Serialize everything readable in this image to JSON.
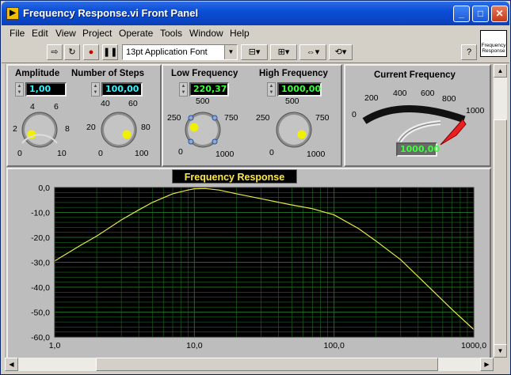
{
  "window": {
    "title": "Frequency Response.vi Front Panel",
    "icon_glyph": "▶"
  },
  "menu": [
    "File",
    "Edit",
    "View",
    "Project",
    "Operate",
    "Tools",
    "Window",
    "Help"
  ],
  "toolbar": {
    "font_label": "13pt Application Font",
    "help_label": "?"
  },
  "vi_icon_label": "Frequency Response",
  "controls": {
    "amplitude": {
      "label": "Amplitude",
      "value": "1,00",
      "ticks": [
        "4",
        "6",
        "2",
        "8",
        "0",
        "10"
      ],
      "level": 0.1
    },
    "steps": {
      "label": "Number of Steps",
      "value": "100,00",
      "ticks": [
        "40",
        "60",
        "20",
        "80",
        "0",
        "100"
      ],
      "level": 1.0
    },
    "low_freq": {
      "label": "Low Frequency",
      "value": "220,37",
      "ticks": [
        "500",
        "250",
        "750",
        "0",
        "1000"
      ],
      "level": 0.22
    },
    "high_freq": {
      "label": "High Frequency",
      "value": "1000,00",
      "ticks": [
        "500",
        "250",
        "750",
        "0",
        "1000"
      ],
      "level": 1.0
    }
  },
  "gauge": {
    "label": "Current Frequency",
    "value": "1000,00",
    "ticks": [
      "0",
      "200",
      "400",
      "600",
      "800",
      "1000"
    ],
    "level": 1.0
  },
  "chart_data": {
    "type": "line",
    "title": "Frequency Response",
    "xscale": "log",
    "xlim": [
      1,
      1000
    ],
    "ylim": [
      -60,
      0
    ],
    "xticks": [
      "1,0",
      "10,0",
      "100,0",
      "1000,0"
    ],
    "yticks": [
      "0,0",
      "-10,0",
      "-20,0",
      "-30,0",
      "-40,0",
      "-50,0",
      "-60,0"
    ],
    "grid": true,
    "series": [
      {
        "color": "#e8e84a",
        "x": [
          1,
          1.5,
          2,
          3,
          4,
          5,
          7,
          9,
          10,
          12,
          15,
          20,
          30,
          50,
          70,
          100,
          150,
          200,
          300,
          500,
          700,
          1000
        ],
        "y": [
          -29.5,
          -23.5,
          -19.5,
          -13,
          -9,
          -6,
          -2.5,
          -1,
          -0.5,
          -0.4,
          -1,
          -2.5,
          -4.5,
          -7,
          -8.5,
          -11,
          -16.5,
          -21.5,
          -29,
          -41,
          -49,
          -57
        ]
      }
    ]
  },
  "colors": {
    "plot_bg": "#000000",
    "grid": "#1e6b1e",
    "trace": "#e8e8e8",
    "needle": "#ff2020"
  }
}
